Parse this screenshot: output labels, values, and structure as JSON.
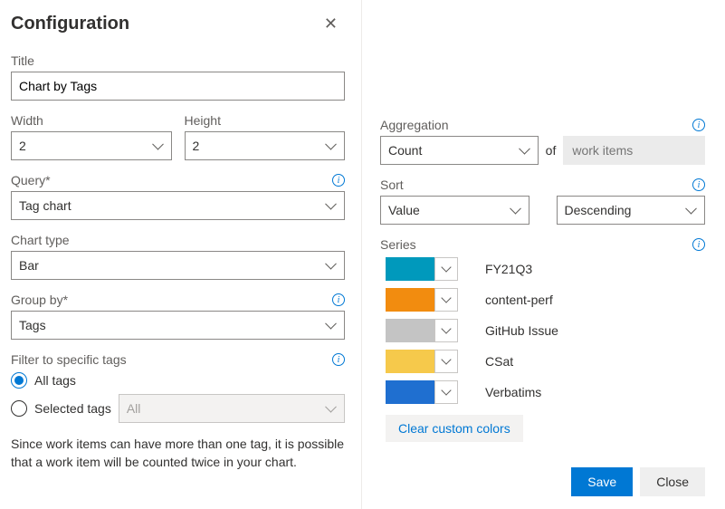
{
  "header": {
    "title": "Configuration"
  },
  "title_field": {
    "label": "Title",
    "value": "Chart by Tags"
  },
  "width_field": {
    "label": "Width",
    "value": "2"
  },
  "height_field": {
    "label": "Height",
    "value": "2"
  },
  "query_field": {
    "label": "Query*",
    "value": "Tag chart"
  },
  "chart_type_field": {
    "label": "Chart type",
    "value": "Bar"
  },
  "group_by_field": {
    "label": "Group by*",
    "value": "Tags"
  },
  "filter_section": {
    "label": "Filter to specific tags",
    "all_tags_label": "All tags",
    "selected_tags_label": "Selected tags",
    "selected_tags_value": "All",
    "selected_radio": "all"
  },
  "note_text": "Since work items can have more than one tag, it is possible that a work item will be counted twice in your chart.",
  "aggregation": {
    "label": "Aggregation",
    "value": "Count",
    "of_label": "of",
    "target": "work items"
  },
  "sort": {
    "label": "Sort",
    "field": "Value",
    "direction": "Descending"
  },
  "series_section": {
    "label": "Series",
    "clear_label": "Clear custom colors",
    "items": [
      {
        "color": "#0099bc",
        "label": "FY21Q3"
      },
      {
        "color": "#f28c0f",
        "label": "content-perf"
      },
      {
        "color": "#c4c4c4",
        "label": "GitHub Issue"
      },
      {
        "color": "#f6c94b",
        "label": "CSat"
      },
      {
        "color": "#1f6fd0",
        "label": "Verbatims"
      }
    ]
  },
  "footer": {
    "save": "Save",
    "close": "Close"
  }
}
